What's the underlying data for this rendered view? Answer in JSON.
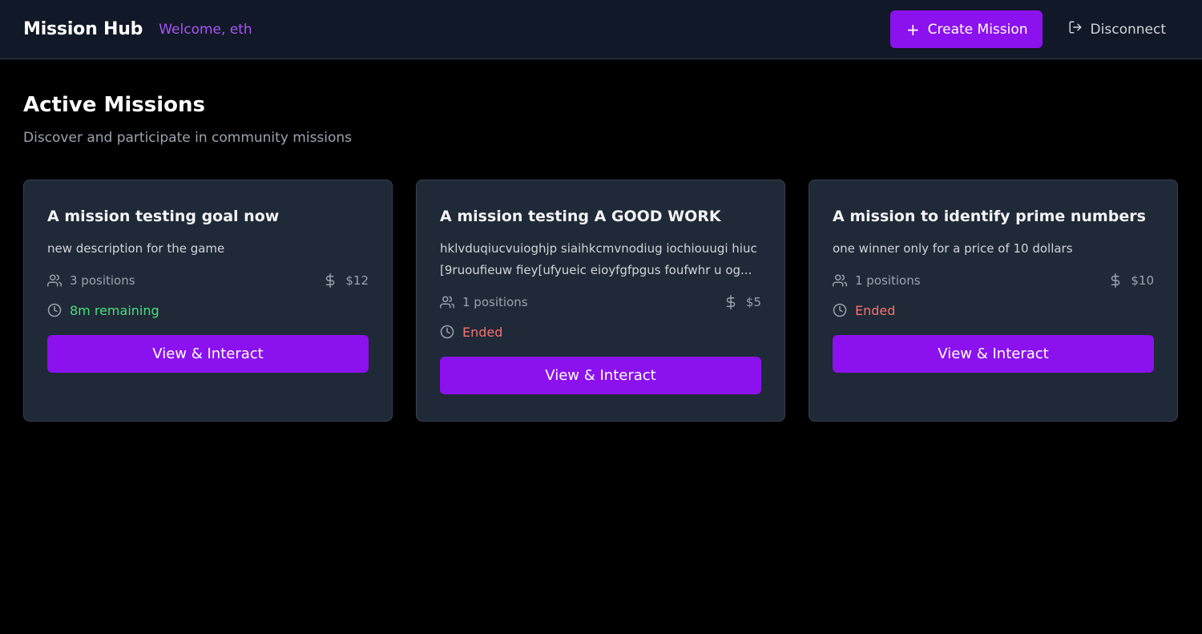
{
  "header": {
    "app_title": "Mission Hub",
    "welcome": "Welcome, eth",
    "create_label": "Create Mission",
    "disconnect_label": "Disconnect"
  },
  "main": {
    "title": "Active Missions",
    "subtitle": "Discover and participate in community missions"
  },
  "colors": {
    "accent": "#8b12ee",
    "welcome": "#a855f7",
    "remaining": "#4ade80",
    "ended": "#f87171"
  },
  "missions": [
    {
      "title": "A mission testing goal now",
      "description": "new description for the game",
      "positions": "3 positions",
      "price": "$12",
      "time": "8m remaining",
      "status": "active",
      "button": "View & Interact"
    },
    {
      "title": "A mission testing A GOOD WORK",
      "description": "hklvduqiucvuioghjp siaihkcmvnodiug iochiouugi hiuc [9ruoufieuw fiey[ufyueic eioyfgfpgus foufwhr u og...",
      "positions": "1 positions",
      "price": "$5",
      "time": "Ended",
      "status": "ended",
      "button": "View & Interact"
    },
    {
      "title": "A mission to identify prime numbers",
      "description": "one winner only for a price of 10 dollars",
      "positions": "1 positions",
      "price": "$10",
      "time": "Ended",
      "status": "ended",
      "button": "View & Interact"
    }
  ]
}
